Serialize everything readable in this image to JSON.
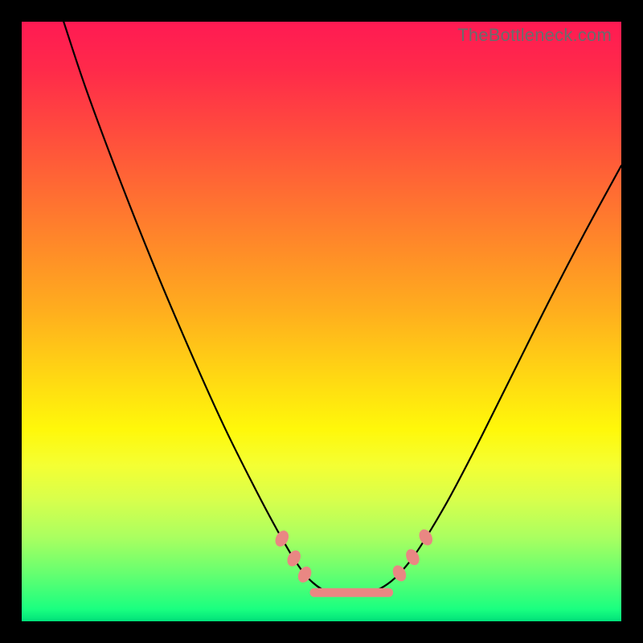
{
  "watermark": "TheBottleneck.com",
  "chart_data": {
    "type": "line",
    "title": "",
    "xlabel": "",
    "ylabel": "",
    "xlim": [
      0,
      100
    ],
    "ylim": [
      0,
      100
    ],
    "note": "Axes are unlabeled in the source image; values are estimated geometric positions in percent of plot area (0,0 = top-left).",
    "series": [
      {
        "name": "curve",
        "type": "line",
        "points": [
          {
            "x": 7.0,
            "y": 0.0
          },
          {
            "x": 11.0,
            "y": 12.0
          },
          {
            "x": 17.0,
            "y": 28.0
          },
          {
            "x": 23.0,
            "y": 43.0
          },
          {
            "x": 29.0,
            "y": 57.0
          },
          {
            "x": 34.0,
            "y": 68.0
          },
          {
            "x": 39.0,
            "y": 78.0
          },
          {
            "x": 43.0,
            "y": 85.5
          },
          {
            "x": 46.0,
            "y": 90.5
          },
          {
            "x": 48.5,
            "y": 93.5
          },
          {
            "x": 51.5,
            "y": 95.3
          },
          {
            "x": 55.0,
            "y": 95.5
          },
          {
            "x": 58.5,
            "y": 95.0
          },
          {
            "x": 61.0,
            "y": 93.8
          },
          {
            "x": 63.5,
            "y": 91.5
          },
          {
            "x": 66.5,
            "y": 87.5
          },
          {
            "x": 71.0,
            "y": 80.0
          },
          {
            "x": 76.0,
            "y": 70.5
          },
          {
            "x": 82.0,
            "y": 58.5
          },
          {
            "x": 88.0,
            "y": 46.5
          },
          {
            "x": 94.0,
            "y": 35.0
          },
          {
            "x": 100.0,
            "y": 24.0
          }
        ]
      }
    ],
    "markers": [
      {
        "x": 43.4,
        "y": 86.2
      },
      {
        "x": 45.4,
        "y": 89.5
      },
      {
        "x": 47.2,
        "y": 92.2
      },
      {
        "x": 63.0,
        "y": 92.0
      },
      {
        "x": 65.2,
        "y": 89.3
      },
      {
        "x": 67.4,
        "y": 86.0
      }
    ],
    "trough_band": {
      "x_start": 48.8,
      "x_end": 61.2,
      "y": 95.2
    }
  }
}
